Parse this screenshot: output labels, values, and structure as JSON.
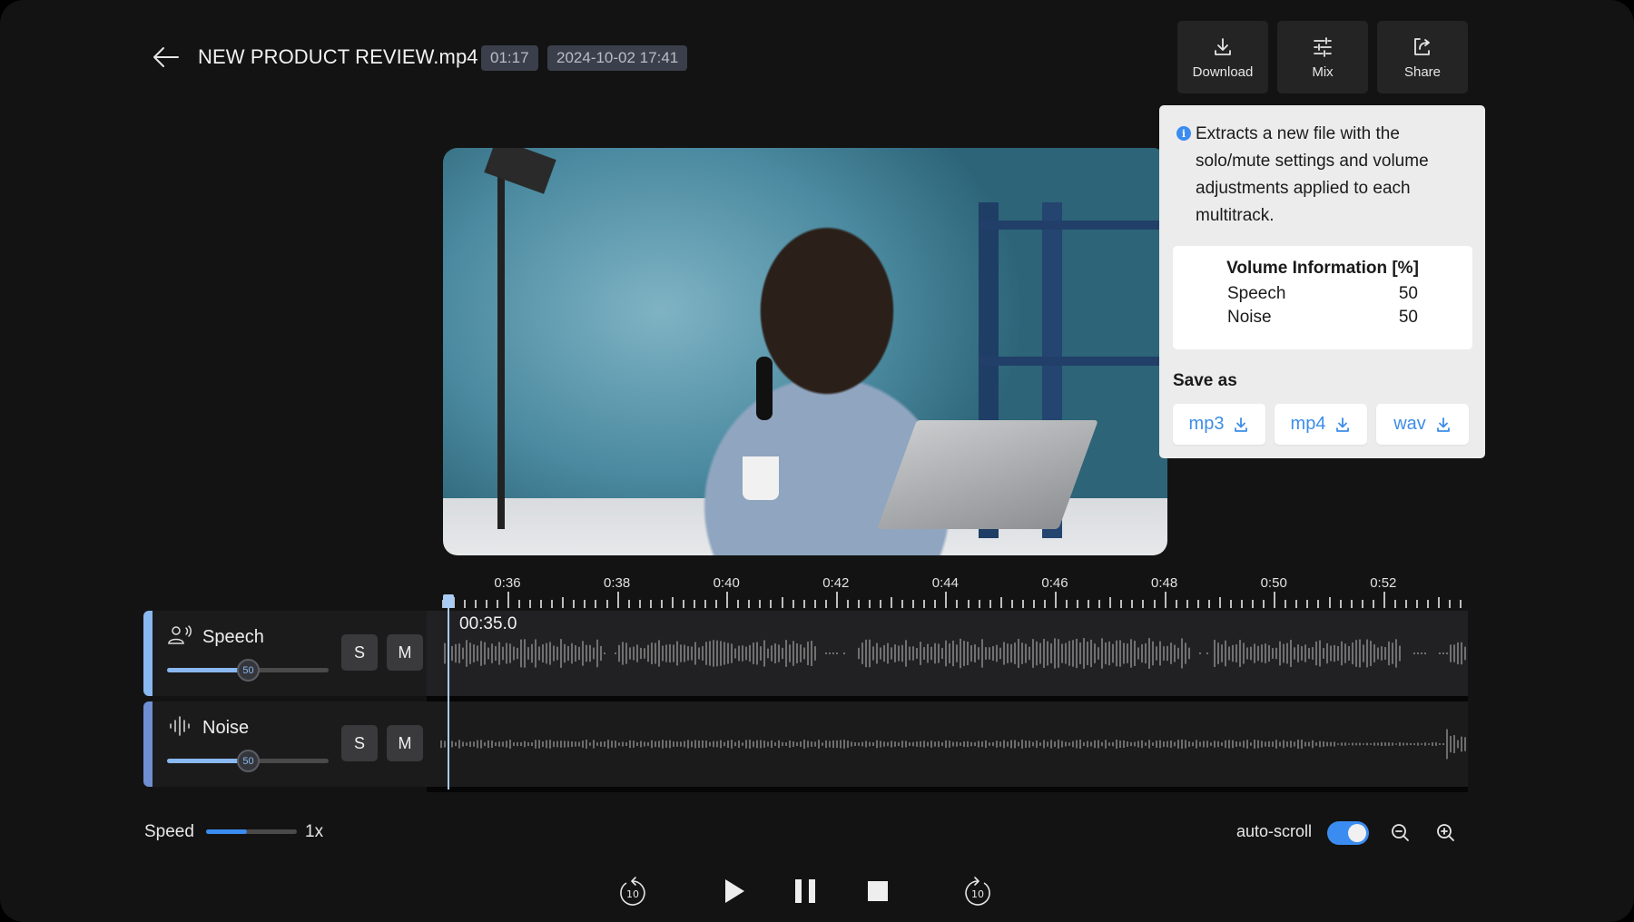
{
  "header": {
    "back_label": "back",
    "title": "NEW PRODUCT REVIEW.mp4",
    "duration": "01:17",
    "date": "2024-10-02 17:41"
  },
  "toolbar": {
    "download_label": "Download",
    "mix_label": "Mix",
    "share_label": "Share"
  },
  "popover": {
    "info_text": "Extracts a new file with the solo/mute settings and volume adjustments applied to each multitrack.",
    "volume_title": "Volume Information [%]",
    "volume_rows": [
      {
        "name": "Speech",
        "value": "50"
      },
      {
        "name": "Noise",
        "value": "50"
      }
    ],
    "save_as_label": "Save as",
    "formats": [
      "mp3",
      "mp4",
      "wav"
    ]
  },
  "video": {
    "description": "Man at desk with microphone and laptop, blue background"
  },
  "timeline": {
    "tick_labels": [
      "0:36",
      "0:38",
      "0:40",
      "0:42",
      "0:44",
      "0:46",
      "0:48",
      "0:50",
      "0:52"
    ],
    "current_time": "00:35.0",
    "playhead_seconds": 35.0
  },
  "tracks": [
    {
      "name": "Speech",
      "volume": 50,
      "volume_label": "50",
      "solo_label": "S",
      "mute_label": "M",
      "color": "#8ab8f0",
      "icon": "speaker-person-icon"
    },
    {
      "name": "Noise",
      "volume": 50,
      "volume_label": "50",
      "solo_label": "S",
      "mute_label": "M",
      "color": "#6f8fd2",
      "icon": "waveform-icon"
    }
  ],
  "controls": {
    "speed_label": "Speed",
    "speed_value": "1x",
    "speed_fraction": 0.45,
    "autoscroll_label": "auto-scroll",
    "autoscroll_on": true
  },
  "playback": {
    "rewind_label": "10",
    "forward_label": "10"
  },
  "colors": {
    "accent": "#3b8cf0",
    "track_speech": "#8ab8f0",
    "track_noise": "#6f8fd2",
    "background": "#131313"
  }
}
